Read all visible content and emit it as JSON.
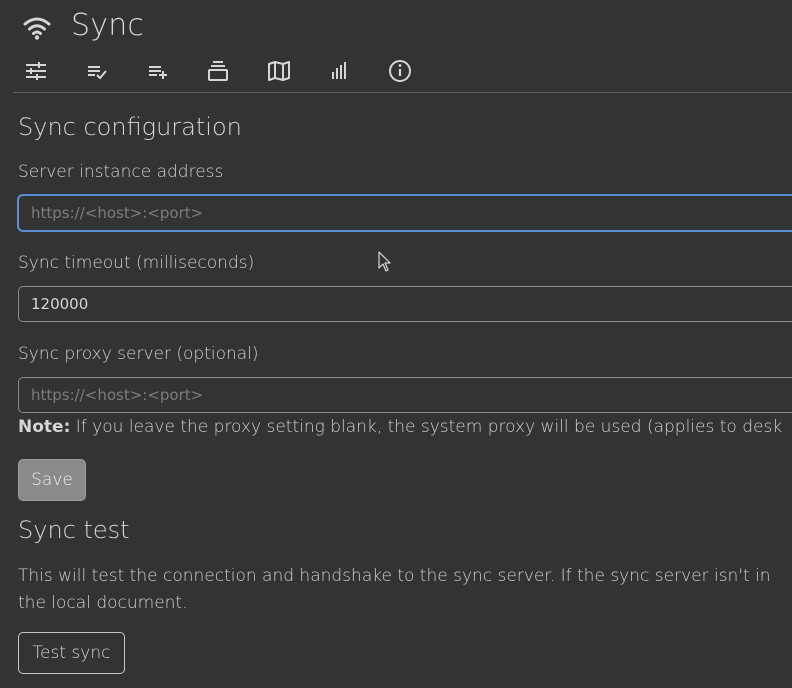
{
  "header": {
    "title": "Sync",
    "icon": "wifi-icon"
  },
  "toolbar": {
    "items": [
      {
        "icon": "tune-icon"
      },
      {
        "icon": "list-check-icon"
      },
      {
        "icon": "list-add-icon"
      },
      {
        "icon": "stack-icon"
      },
      {
        "icon": "map-icon"
      },
      {
        "icon": "bar-chart-icon"
      },
      {
        "icon": "info-icon"
      }
    ]
  },
  "config": {
    "title": "Sync configuration",
    "server_label": "Server instance address",
    "server_value": "",
    "server_placeholder": "https://<host>:<port>",
    "timeout_label": "Sync timeout (milliseconds)",
    "timeout_value": "120000",
    "proxy_label": "Sync proxy server (optional)",
    "proxy_value": "",
    "proxy_placeholder": "https://<host>:<port>",
    "note_bold": "Note:",
    "note_text": " If you leave the proxy setting blank, the system proxy will be used (applies to desk",
    "save_label": "Save"
  },
  "test": {
    "title": "Sync test",
    "desc_line1": "This will test the connection and handshake to the sync server. If the sync server isn't in",
    "desc_line2": "the local document.",
    "button_label": "Test sync"
  },
  "colors": {
    "background": "#333333",
    "focus": "#5a8fd8",
    "save_button": "#8a8a8a"
  }
}
